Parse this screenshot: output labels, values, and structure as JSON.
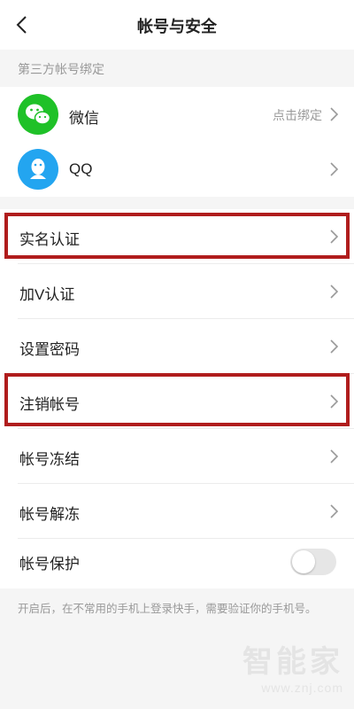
{
  "header": {
    "title": "帐号与安全"
  },
  "third_party": {
    "section_label": "第三方帐号绑定",
    "items": [
      {
        "label": "微信",
        "status": "点击绑定",
        "icon": "wechat-icon"
      },
      {
        "label": "QQ",
        "status": "",
        "icon": "qq-icon"
      }
    ]
  },
  "settings": {
    "items": [
      {
        "label": "实名认证"
      },
      {
        "label": "加V认证"
      },
      {
        "label": "设置密码"
      },
      {
        "label": "注销帐号"
      },
      {
        "label": "帐号冻结"
      },
      {
        "label": "帐号解冻"
      },
      {
        "label": "帐号保护",
        "toggle_on": false
      }
    ]
  },
  "hint": "开启后，在不常用的手机上登录快手，需要验证你的手机号。",
  "watermark": {
    "brand": "智能家",
    "url": "www.znj.com"
  },
  "colors": {
    "highlight": "#b01d1d",
    "wechat": "#1fc128",
    "qq": "#23a5f0"
  }
}
